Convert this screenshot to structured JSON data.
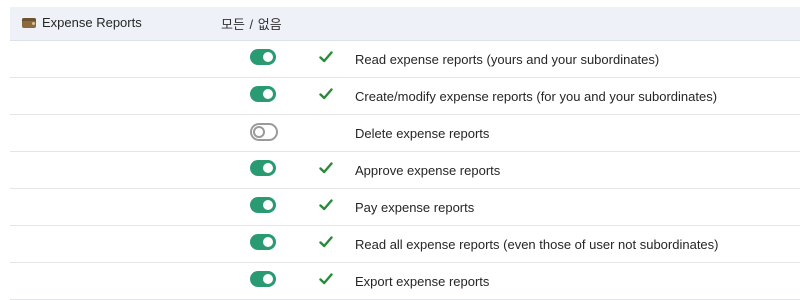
{
  "section": {
    "module_icon": "wallet-icon",
    "module_label": "Expense Reports",
    "all_label": "모든",
    "separator": "/",
    "none_label": "없음"
  },
  "permissions": [
    {
      "label": "Read expense reports (yours and your subordinates)",
      "enabled": true
    },
    {
      "label": "Create/modify expense reports (for you and your subordinates)",
      "enabled": true
    },
    {
      "label": "Delete expense reports",
      "enabled": false
    },
    {
      "label": "Approve expense reports",
      "enabled": true
    },
    {
      "label": "Pay expense reports",
      "enabled": true
    },
    {
      "label": "Read all expense reports (even those of user not subordinates)",
      "enabled": true
    },
    {
      "label": "Export expense reports",
      "enabled": true
    }
  ],
  "colors": {
    "toggle_on": "#2a9a73",
    "toggle_off_border": "#9a9a9a",
    "check": "#2a8a3a",
    "header_bg": "#eef1f8"
  },
  "icons": {
    "toggle_on": "toggle-on-icon",
    "toggle_off": "toggle-off-icon",
    "check": "check-icon"
  }
}
